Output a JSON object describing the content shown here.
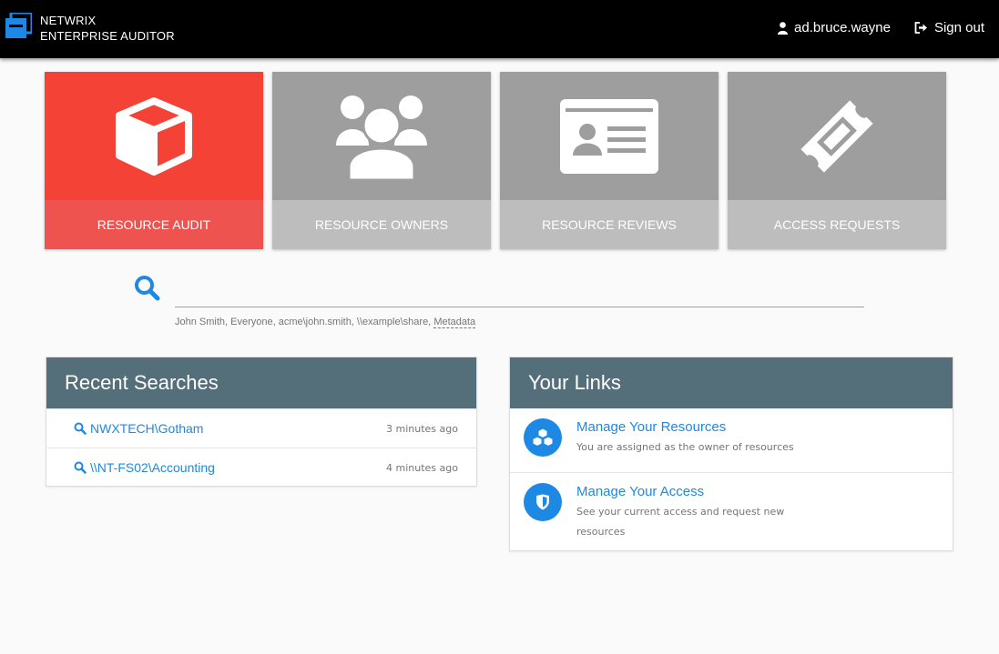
{
  "header": {
    "brand_line1": "NETWRIX",
    "brand_line2": "ENTERPRISE AUDITOR",
    "username": "ad.bruce.wayne",
    "signout_label": "Sign out"
  },
  "tiles": [
    {
      "label": "RESOURCE AUDIT",
      "icon": "cube-icon",
      "active": true
    },
    {
      "label": "RESOURCE OWNERS",
      "icon": "users-icon",
      "active": false
    },
    {
      "label": "RESOURCE REVIEWS",
      "icon": "id-card-icon",
      "active": false
    },
    {
      "label": "ACCESS REQUESTS",
      "icon": "ticket-icon",
      "active": false
    }
  ],
  "search": {
    "value": "",
    "hint_examples": "John Smith, Everyone, acme\\john.smith, \\\\example\\share, ",
    "hint_metadata": "Metadata"
  },
  "recent_searches": {
    "title": "Recent Searches",
    "items": [
      {
        "label": "NWXTECH\\Gotham",
        "time": "3 minutes ago"
      },
      {
        "label": "\\\\NT-FS02\\Accounting",
        "time": "4 minutes ago"
      }
    ]
  },
  "your_links": {
    "title": "Your Links",
    "items": [
      {
        "title": "Manage Your Resources",
        "description": "You are assigned as the owner of resources",
        "icon": "cubes-icon"
      },
      {
        "title": "Manage Your Access",
        "description": "See your current access and request new resources",
        "icon": "shield-icon"
      }
    ]
  },
  "colors": {
    "accent": "#1e88e5",
    "active_tile": "#f44336",
    "card_header": "#546e7a"
  }
}
